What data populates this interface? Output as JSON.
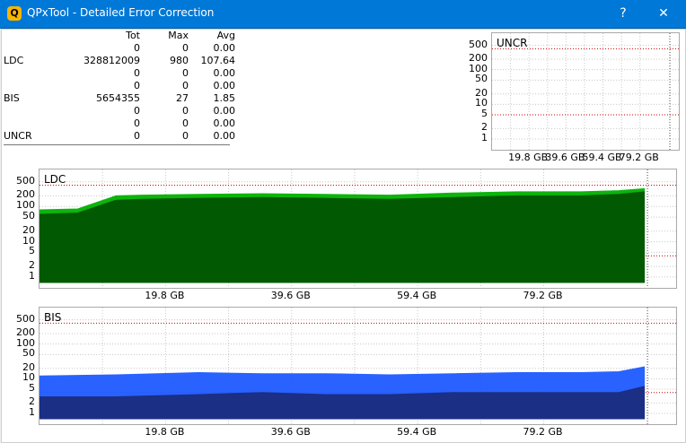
{
  "window": {
    "title": "QPxTool - Detailed Error Correction",
    "help_label": "?",
    "close_label": "✕"
  },
  "stats": {
    "headers": [
      "",
      "Tot",
      "Max",
      "Avg"
    ],
    "rows": [
      [
        "",
        "0",
        "0",
        "0.00"
      ],
      [
        "LDC",
        "328812009",
        "980",
        "107.64"
      ],
      [
        "",
        "0",
        "0",
        "0.00"
      ],
      [
        "",
        "0",
        "0",
        "0.00"
      ],
      [
        "BIS",
        "5654355",
        "27",
        "1.85"
      ],
      [
        "",
        "0",
        "0",
        "0.00"
      ],
      [
        "",
        "0",
        "0",
        "0.00"
      ],
      [
        "UNCR",
        "0",
        "0",
        "0.00"
      ]
    ]
  },
  "chart_data": [
    {
      "type": "area",
      "title": "UNCR",
      "y_scale": "log",
      "y_ticks": [
        "500",
        "200",
        "100",
        "50",
        "20",
        "10",
        "5",
        "2",
        "1"
      ],
      "x_ticks": [
        "19.8 GB",
        "39.6 GB",
        "59.4 GB",
        "79.2 GB"
      ],
      "series": []
    },
    {
      "type": "area",
      "title": "LDC",
      "y_scale": "log",
      "y_ticks": [
        "500",
        "200",
        "100",
        "50",
        "20",
        "10",
        "5",
        "2",
        "1"
      ],
      "x_ticks": [
        "19.8 GB",
        "39.6 GB",
        "59.4 GB",
        "79.2 GB"
      ],
      "x_end_gb": 95.5,
      "series": [
        {
          "color": "#00b000",
          "x": [
            0,
            6,
            12,
            16,
            25,
            35,
            45,
            55,
            65,
            75,
            85,
            91,
            95
          ],
          "values": [
            80,
            85,
            200,
            210,
            220,
            230,
            220,
            210,
            240,
            260,
            260,
            280,
            320
          ]
        },
        {
          "color": "#005000",
          "x": [
            0,
            6,
            12,
            16,
            25,
            35,
            45,
            55,
            65,
            75,
            85,
            91,
            95
          ],
          "values": [
            60,
            65,
            150,
            160,
            170,
            180,
            170,
            160,
            180,
            200,
            200,
            220,
            260
          ]
        }
      ],
      "colors": {
        "threshold": "#cc0000"
      }
    },
    {
      "type": "area",
      "title": "BIS",
      "y_scale": "log",
      "y_ticks": [
        "500",
        "200",
        "100",
        "50",
        "20",
        "10",
        "5",
        "2",
        "1"
      ],
      "x_ticks": [
        "19.8 GB",
        "39.6 GB",
        "59.4 GB",
        "79.2 GB"
      ],
      "x_end_gb": 95.5,
      "series": [
        {
          "color": "#1e5aff",
          "x": [
            0,
            12,
            25,
            35,
            45,
            55,
            65,
            75,
            85,
            91,
            95
          ],
          "values": [
            12,
            13,
            15,
            14,
            14,
            13,
            14,
            15,
            15,
            16,
            22
          ]
        },
        {
          "color": "#1a2a78",
          "x": [
            0,
            6,
            12,
            25,
            35,
            45,
            55,
            65,
            75,
            85,
            91,
            95
          ],
          "values": [
            3,
            3,
            3,
            3.5,
            4,
            3.5,
            3.5,
            4,
            4,
            4,
            4,
            6
          ]
        }
      ],
      "colors": {
        "threshold": "#cc0000"
      }
    }
  ]
}
